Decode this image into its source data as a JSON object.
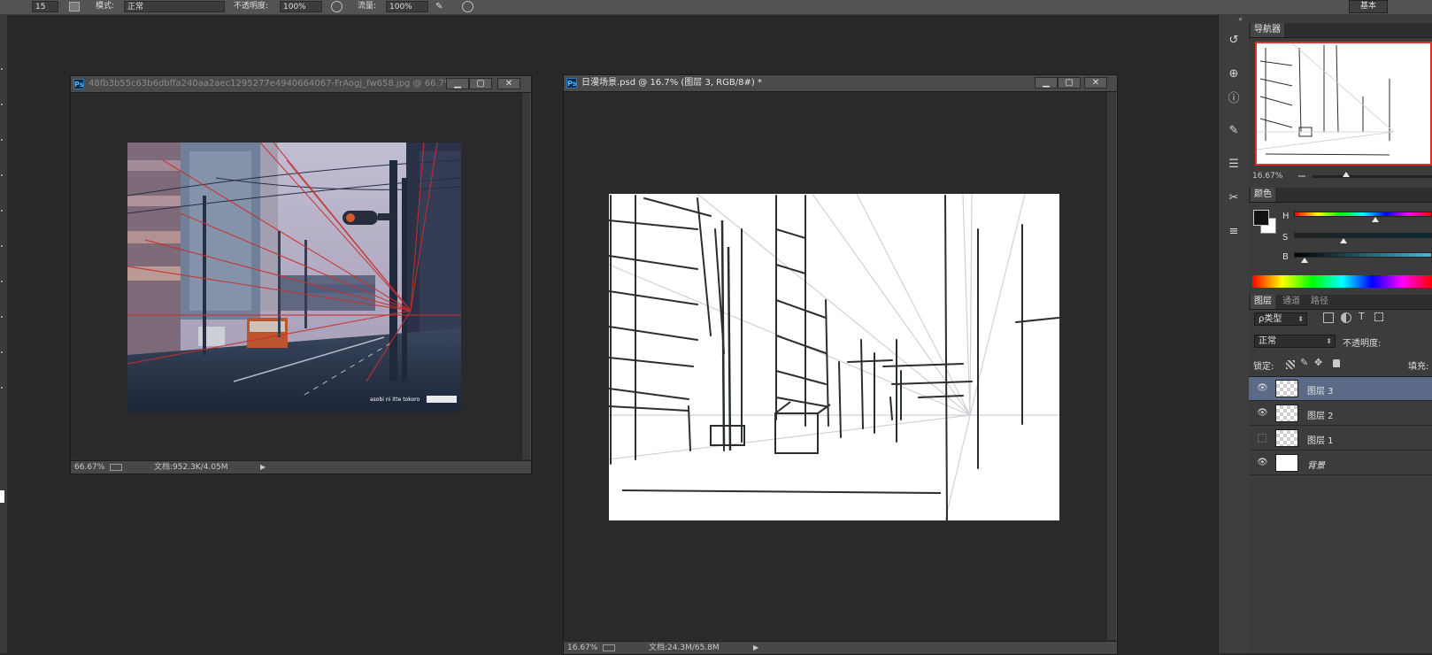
{
  "options_bar": {
    "size_value": "15",
    "mode_label": "模式:",
    "mode_value": "正常",
    "opacity_label": "不透明度:",
    "opacity_value": "100%",
    "flow_label": "流量:",
    "flow_value": "100%",
    "right_button": "基本"
  },
  "ref_window": {
    "title": "48fb3b55c63b6dbffa240aa2aec1295277e4940664067-FrAogj_fw658.jpg @ 66.7% (图层...",
    "zoom": "66.67%",
    "file_info": "文档:952.3K/4.05M",
    "watermark": "asobi ni itte tokoro"
  },
  "main_window": {
    "title": "日漫场景.psd @ 16.7% (图层 3, RGB/8#) *",
    "zoom": "16.67%",
    "file_info": "文档:24.3M/65.8M"
  },
  "navigator": {
    "tab": "导航器",
    "zoom": "16.67%"
  },
  "color_panel": {
    "tab": "颜色",
    "h_label": "H",
    "s_label": "S",
    "b_label": "B",
    "h_value_fraction": 0.59,
    "s_value_fraction": 0.36,
    "b_value_fraction": 0.08
  },
  "layers_panel": {
    "tabs": [
      "图层",
      "通道",
      "路径"
    ],
    "filter_label": "ρ类型",
    "blend_mode": "正常",
    "opacity_label": "不透明度:",
    "lock_label": "锁定:",
    "fill_label": "填充:",
    "layers": [
      {
        "name": "图层 3",
        "visible": true,
        "selected": true
      },
      {
        "name": "图层 2",
        "visible": true,
        "selected": false
      },
      {
        "name": "图层 1",
        "visible": false,
        "selected": false
      },
      {
        "name": "背景",
        "visible": true,
        "selected": false
      }
    ]
  },
  "colors": {
    "selection": "#5b6a86",
    "red_guides": "#e0302a",
    "panel_bg": "#3c3c3c"
  }
}
